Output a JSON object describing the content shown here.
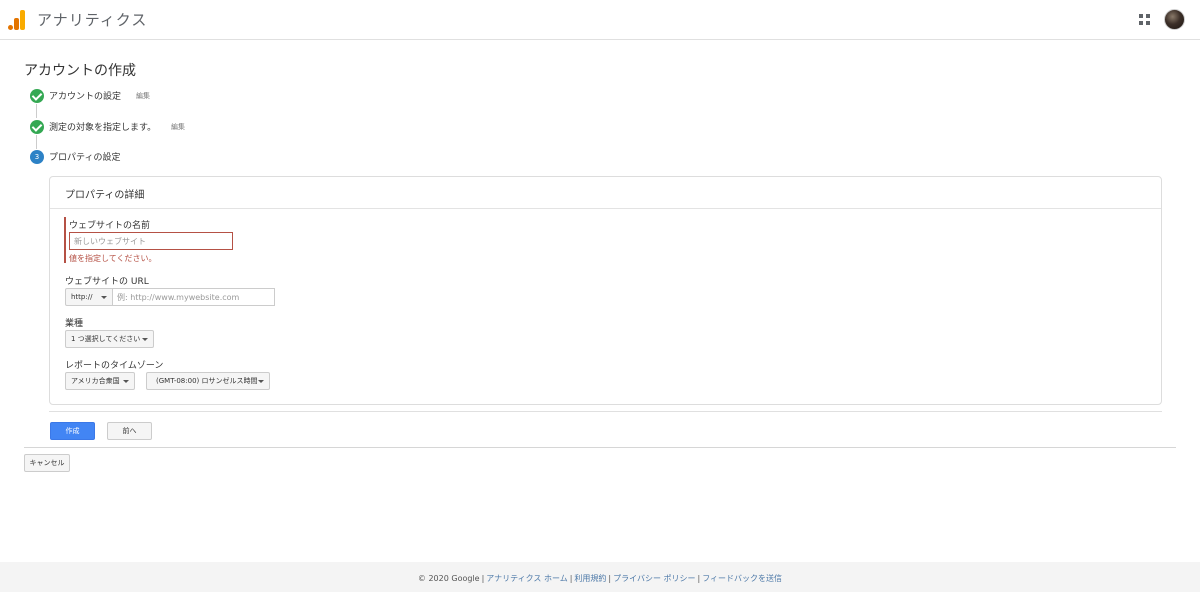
{
  "header": {
    "app_title": "アナリティクス",
    "logo_icon": "analytics-logo-icon",
    "apps_icon": "apps-grid-icon",
    "avatar_icon": "user-avatar"
  },
  "page": {
    "title": "アカウントの作成"
  },
  "steps": [
    {
      "label": "アカウントの設定",
      "edit": "編集",
      "status": "done"
    },
    {
      "label": "測定の対象を指定します。",
      "edit": "編集",
      "status": "done"
    },
    {
      "label": "プロパティの設定",
      "number": "3",
      "status": "current"
    }
  ],
  "card": {
    "title": "プロパティの詳細",
    "website_name": {
      "label": "ウェブサイトの名前",
      "placeholder": "新しいウェブサイト",
      "value": "",
      "error": "値を指定してください。"
    },
    "website_url": {
      "label": "ウェブサイトの URL",
      "protocol": "http://",
      "placeholder": "例: http://www.mywebsite.com",
      "value": ""
    },
    "industry": {
      "label": "業種",
      "selected": "1 つ選択してください"
    },
    "timezone": {
      "label": "レポートのタイムゾーン",
      "country": "アメリカ合衆国",
      "zone": "(GMT-08:00) ロサンゼルス時間"
    }
  },
  "actions": {
    "create": "作成",
    "previous": "前へ",
    "cancel": "キャンセル"
  },
  "footer": {
    "copyright": "© 2020 Google",
    "links": [
      "アナリティクス ホーム",
      "利用規約",
      "プライバシー ポリシー",
      "フィードバックを送信"
    ]
  },
  "colors": {
    "primary": "#4285f4",
    "success": "#34a853",
    "step_current": "#2d82c6",
    "error": "#b55145",
    "link": "#4d79a8"
  }
}
